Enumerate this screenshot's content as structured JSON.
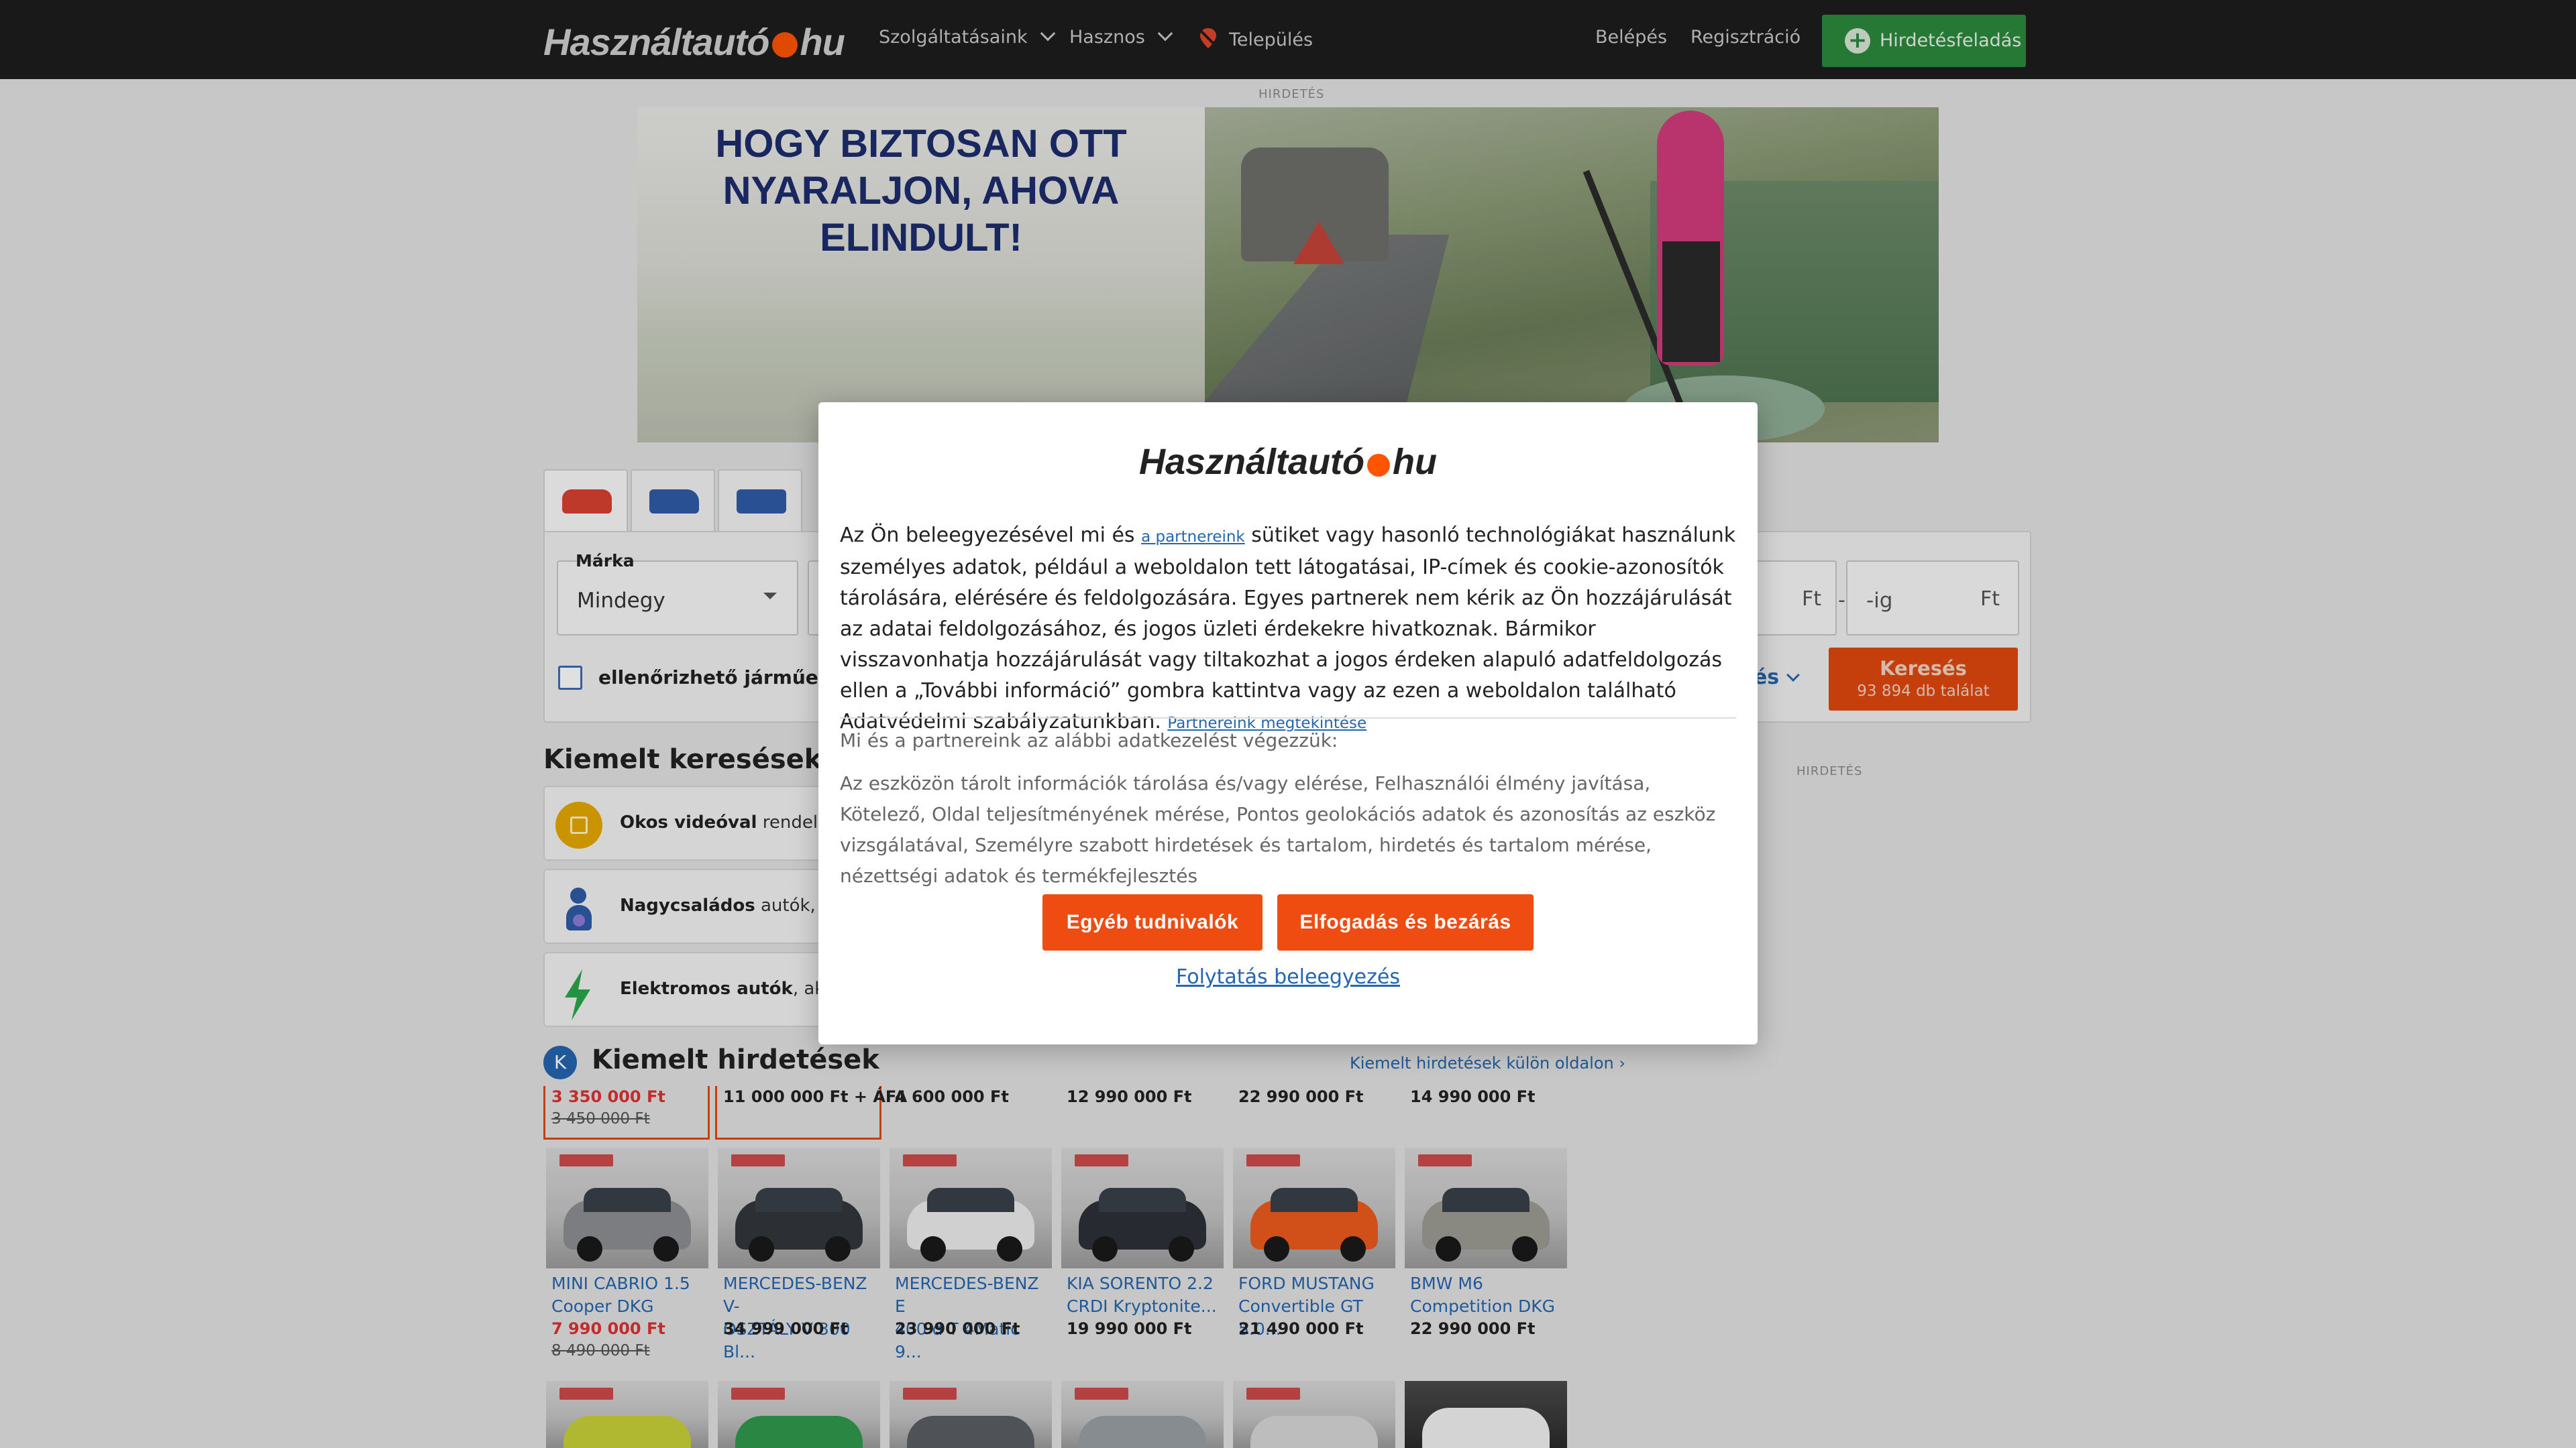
{
  "header": {
    "logo_left": "Használtautó",
    "logo_right": "hu",
    "nav": {
      "services": "Szolgáltatásaink",
      "useful": "Hasznos",
      "location": "Település"
    },
    "login": "Belépés",
    "register": "Regisztráció",
    "post_ad": "Hirdetésfeladás"
  },
  "ad": {
    "label": "HIRDETÉS",
    "headline_1": "HOGY BIZTOSAN OTT",
    "headline_2": "NYARALJON, AHOVA ELINDULT!"
  },
  "search": {
    "brand_label": "Márka",
    "brand_value": "Mindegy",
    "checkbox_label": "ellenőrizhető járműelő",
    "price_to_placeholder": "-ig",
    "currency": "Ft",
    "dash": "-",
    "more_link": "sés",
    "button_label": "Keresés",
    "results_count": "93 894 db találat"
  },
  "featured_searches": {
    "title": "Kiemelt keresések",
    "items": [
      {
        "bold": "Okos videóval",
        "rest": " rendelkez"
      },
      {
        "bold": "Nagycsaládos",
        "rest": " autók, 7 -"
      },
      {
        "bold": "Elektromos autók",
        "rest": ", akár"
      }
    ]
  },
  "side_ad_label": "HIRDETÉS",
  "featured_ads": {
    "badge": "K",
    "title": "Kiemelt hirdetések",
    "separate_page_link": "Kiemelt hirdetések külön oldalon ›",
    "top_row": [
      {
        "price": "3 350 000 Ft",
        "old": "3 450 000 Ft"
      },
      {
        "price": "11 000 000 Ft + ÁFA",
        "old": ""
      },
      {
        "price": "4 600 000 Ft",
        "old": ""
      },
      {
        "price": "12 990 000 Ft",
        "old": ""
      },
      {
        "price": "22 990 000 Ft",
        "old": ""
      },
      {
        "price": "14 990 000 Ft",
        "old": ""
      }
    ],
    "cards": [
      {
        "name_1": "MINI CABRIO 1.5",
        "name_2": "Cooper DKG",
        "price": "7 990 000 Ft",
        "old": "8 490 000 Ft",
        "color": "#8c8f93"
      },
      {
        "name_1": "MERCEDES-BENZ V-",
        "name_2": "OSZTÁLY V 300 Bl...",
        "price": "34 999 000 Ft",
        "old": "",
        "color": "#33373d"
      },
      {
        "name_1": "MERCEDES-BENZ E",
        "name_2": "400 d T 4Matic 9...",
        "price": "23 990 000 Ft",
        "old": "",
        "color": "#ededed"
      },
      {
        "name_1": "KIA SORENTO 2.2",
        "name_2": "CRDI Kryptonite...",
        "price": "19 990 000 Ft",
        "old": "",
        "color": "#2d3238"
      },
      {
        "name_1": "FORD MUSTANG",
        "name_2": "Convertible GT 5.0...",
        "price": "21 490 000 Ft",
        "old": "",
        "color": "#ee5a1c"
      },
      {
        "name_1": "BMW M6",
        "name_2": "Competition DKG",
        "price": "22 990 000 Ft",
        "old": "",
        "color": "#9d9b93"
      }
    ],
    "bottom_colors": [
      "#c9d23a",
      "#2f9a4d",
      "#5b5f63",
      "#9aa0a6",
      "#d8d8d8",
      "#f2f2f2"
    ]
  },
  "consent": {
    "logo_left": "Használtautó",
    "logo_right": "hu",
    "p1": "Az Ön beleegyezésével mi és ",
    "partners_link": "a partnereink",
    "p2": " sütiket vagy hasonló technológiákat használunk személyes adatok, például a weboldalon tett látogatásai, IP-címek és cookie-azonosítók tárolására, elérésére és feldolgozására. Egyes partnerek nem kérik az Ön hozzájárulását az adatai feldolgozásához, és jogos üzleti érdekekre hivatkoznak. Bármikor visszavonhatja hozzájárulását vagy tiltakozhat a jogos érdeken alapuló adatfeldolgozás ellen a „További információ” gombra kattintva vagy az ezen a weboldalon található Adatvédelmi szabályzatunkban. ",
    "view_partners_link": "Partnereink megtekintése",
    "subtitle": "Mi és a partnereink az alábbi adatkezelést végezzük:",
    "purposes": "Az eszközön tárolt információk tárolása és/vagy elérése, Felhasználói élmény javítása, Kötelező, Oldal teljesítményének mérése, Pontos geolokációs adatok és azonosítás az eszköz vizsgálatával, Személyre szabott hirdetések és tartalom, hirdetés és tartalom mérése, nézettségi adatok és termékfejlesztés",
    "btn_more": "Egyéb tudnivalók",
    "btn_accept": "Elfogadás és bezárás",
    "btn_continue": "Folytatás beleegyezés"
  },
  "colors": {
    "brand_orange": "#ee4c11",
    "header_bg": "#1d1d1d",
    "link_blue": "#2466b0",
    "post_green": "#2c8a3c"
  }
}
